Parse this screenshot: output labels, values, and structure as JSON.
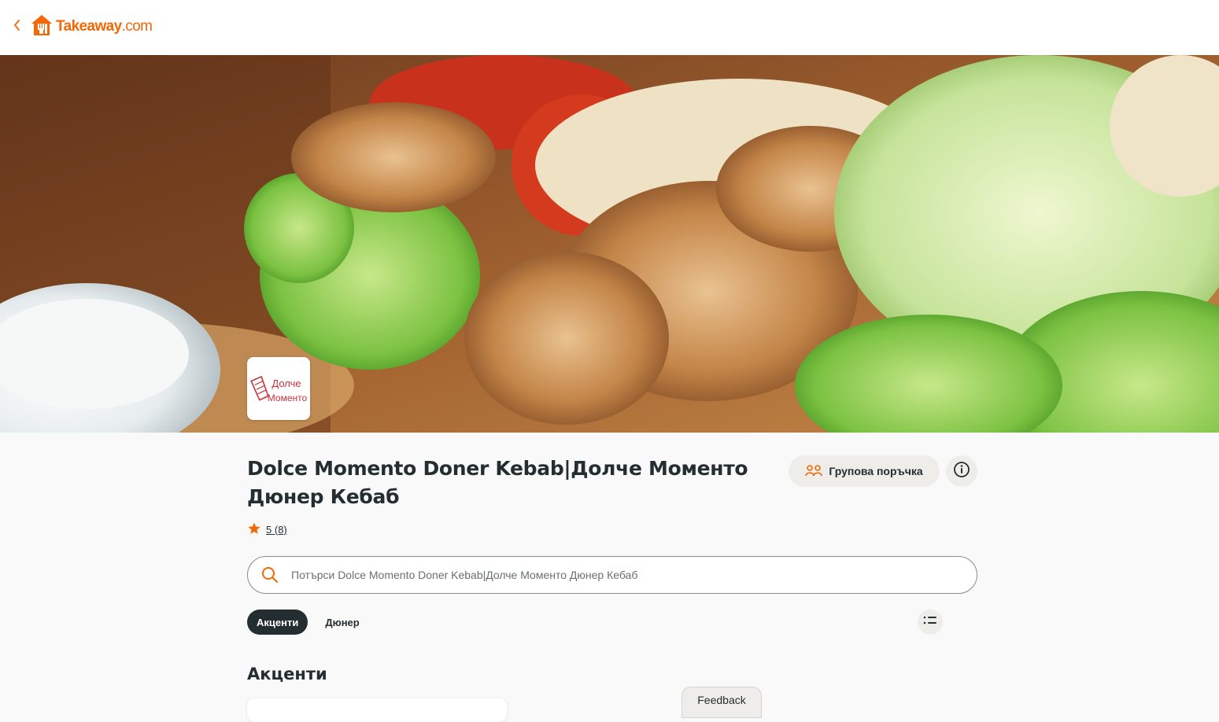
{
  "nav": {
    "back_icon": "chevron-left-icon",
    "logo": {
      "brand": "Takeaway",
      "domain": ".com",
      "icon": "house-fork-icon",
      "color": "#f36805"
    }
  },
  "hero": {
    "restaurant_logo": {
      "line1": "Долче",
      "line2": "Моменто",
      "color": "#c8323c"
    }
  },
  "restaurant": {
    "title": "Dolce Momento Doner Kebab|Долче Моменто Дюнер Кебаб",
    "rating": {
      "score": "5",
      "count": "(8)",
      "icon": "star-icon",
      "color": "#f36805"
    }
  },
  "actions": {
    "group_order_label": "Групова поръчка",
    "group_order_icon": "group-people-icon",
    "info_icon": "info-icon"
  },
  "search": {
    "placeholder": "Потърси Dolce Momento Doner Kebab|Долче Моменто Дюнер Кебаб",
    "icon": "search-icon"
  },
  "categories": {
    "tabs": [
      {
        "label": "Акценти",
        "active": true
      },
      {
        "label": "Дюнер",
        "active": false
      }
    ],
    "list_icon": "list-icon"
  },
  "section": {
    "heading": "Акценти"
  },
  "feedback": {
    "label": "Feedback"
  },
  "colors": {
    "accent": "#f36805",
    "dark": "#242e30",
    "chip_bg": "#efedea"
  }
}
